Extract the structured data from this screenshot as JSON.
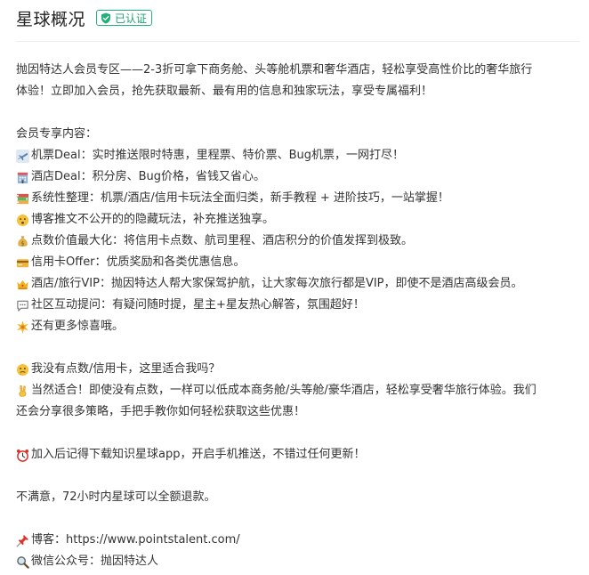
{
  "header": {
    "title": "星球概况",
    "badge": "已认证",
    "badge_color": "#1fa26f"
  },
  "intro": {
    "line1": " 抛因特达人会员专区——2-3折可拿下商务舱、头等舱机票和奢华酒店，轻松享受高性价比的奢华旅行",
    "line2": "体验！立即加入会员，抢先获取最新、最有用的信息和独家玩法，享受专属福利！"
  },
  "features": {
    "heading": "会员专享内容：",
    "items": [
      {
        "icon": "airplane-icon",
        "text": "机票Deal：实时推送限时特惠，里程票、特价票、Bug机票，一网打尽！"
      },
      {
        "icon": "hotel-icon",
        "text": "酒店Deal：积分房、Bug价格，省钱又省心。"
      },
      {
        "icon": "books-icon",
        "text": "系统性整理：机票/酒店/信用卡玩法全面归类，新手教程 + 进阶技巧，一站掌握！"
      },
      {
        "icon": "hushed-face-icon",
        "text": "博客推文不公开的的隐藏玩法，补充推送独享。"
      },
      {
        "icon": "money-bag-icon",
        "text": "点数价值最大化：将信用卡点数、航司里程、酒店积分的价值发挥到极致。"
      },
      {
        "icon": "credit-card-icon",
        "text": "信用卡Offer：优质奖励和各类优惠信息。"
      },
      {
        "icon": "crown-icon",
        "text": "酒店/旅行VIP：抛因特达人帮大家保驾护航，让大家每次旅行都是VIP，即使不是酒店高级会员。"
      },
      {
        "icon": "speech-bubble-icon",
        "text": "社区互动提问：有疑问随时提，星主+星友热心解答，氛围超好！"
      },
      {
        "icon": "sparkle-icon",
        "text": "还有更多惊喜哦。"
      }
    ]
  },
  "faq": {
    "question": "我没有点数/信用卡，这里适合我吗？",
    "answer_line1": "当然适合！即使没有点数，一样可以低成本商务舱/头等舱/豪华酒店，轻松享受奢华旅行体验。我们",
    "answer_line2": "还会分享很多策略，手把手教你如何轻松获取这些优惠！"
  },
  "reminder": "加入后记得下载知识星球app，开启手机推送，不错过任何更新！",
  "refund": "不满意，72小时内星球可以全额退款。",
  "links": {
    "blog": "博客：https://www.pointstalent.com/",
    "wechat": "微信公众号：抛因特达人"
  }
}
